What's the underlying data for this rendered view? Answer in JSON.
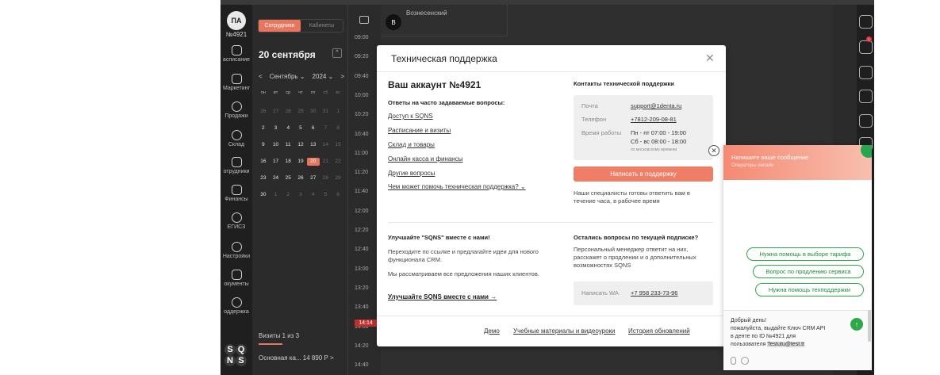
{
  "account": {
    "initials": "ПА",
    "number": "№4921"
  },
  "nav": [
    {
      "label": "асписание",
      "icon": "calendar-icon"
    },
    {
      "label": "Маркетинг",
      "icon": "chat-icon"
    },
    {
      "label": "Продажи",
      "icon": "tag-icon"
    },
    {
      "label": "Склад",
      "icon": "box-icon"
    },
    {
      "label": "отрудники",
      "icon": "users-icon"
    },
    {
      "label": "Финансы",
      "icon": "wallet-icon"
    },
    {
      "label": "ЕГИСЗ",
      "icon": "emblem-icon"
    },
    {
      "label": "Настройки",
      "icon": "gear-icon"
    },
    {
      "label": "окументы",
      "icon": "document-icon"
    },
    {
      "label": "оддержка",
      "icon": "question-icon"
    }
  ],
  "calendar": {
    "tabs": [
      "Сотрудники",
      "Кабинеты"
    ],
    "date_title": "20 сентября",
    "month": "Сентябрь",
    "year": "2024",
    "weekdays": [
      "пн",
      "вт",
      "ср",
      "чт",
      "пт",
      "сб",
      "вс"
    ],
    "weeks": [
      [
        "26",
        "27",
        "28",
        "29",
        "30",
        "31",
        "1"
      ],
      [
        "2",
        "3",
        "4",
        "5",
        "6",
        "7",
        "8"
      ],
      [
        "9",
        "10",
        "11",
        "12",
        "13",
        "14",
        "15"
      ],
      [
        "16",
        "17",
        "18",
        "19",
        "20",
        "21",
        "22"
      ],
      [
        "23",
        "24",
        "25",
        "26",
        "27",
        "28",
        "29"
      ],
      [
        "30",
        "1",
        "2",
        "3",
        "4",
        "5",
        "6"
      ]
    ],
    "selected": "20",
    "visits": "Визиты 1 из 3",
    "sale": "Основная ка... 14 890 Р"
  },
  "times": [
    "09:00",
    "09:20",
    "09:40",
    "10:00",
    "10:20",
    "10:40",
    "11:00",
    "11:20",
    "11:40",
    "12:00",
    "12:20",
    "12:40",
    "13:00",
    "13:20",
    "13:40",
    "14:00",
    "14:20",
    "14:40"
  ],
  "now_time": "14:14",
  "staff": {
    "initial": "В",
    "name": "Вознесенский"
  },
  "modal": {
    "title": "Техническая поддержка",
    "account_title": "Ваш аккаунт №4921",
    "faq_title": "Ответы на часто задаваемые вопросы:",
    "faq_links": [
      "Доступ к SQNS",
      "Расписание и визиты",
      "Склад и товары",
      "Онлайн касса и финансы",
      "Другие вопросы"
    ],
    "help_link": "Чем может помочь техническая поддержка?",
    "contacts_title": "Контакты технической поддержки",
    "contacts": {
      "mail_label": "Почта",
      "mail": "support@1denta.ru",
      "phone_label": "Телефон",
      "phone": "+7812-209-08-81",
      "hours_label": "Время работы",
      "hours_1": "Пн - пт 07:00 - 19:00",
      "hours_2": "Сб - вс 08:00 - 18:00",
      "hours_note": "по московскому времени"
    },
    "write_button": "Написать в поддержку",
    "response_note": "Наши специалисты готовы ответить вам в течение часа, в рабочее время",
    "improve_title": "Улучшайте \"SQNS\" вместе с нами!",
    "improve_p1": "Переходите по ссылке и предлагайте идеи для нового функционала CRM.",
    "improve_p2": "Мы рассматриваем все предложения наших клиентов.",
    "improve_link": "Улучшайте SQNS вместе с нами",
    "sub_title": "Остались вопросы по текущей подписке?",
    "sub_p": "Персональный менеджер ответит на них, расскажет о продлении и о дополнительных возможностях SQNS",
    "wa_label": "Написать WA",
    "wa_phone": "+7 958 233-73-96",
    "footer": [
      "Демо",
      "Учебные материалы и видеоуроки",
      "История обновлений"
    ]
  },
  "chat": {
    "title": "Напишите ваше сообщение",
    "subtitle": "Операторы онлайн",
    "chips": [
      "Нужна помощь в выборе тарифа",
      "Вопрос по продлению сервиса",
      "Нужна помощь техподдержки"
    ],
    "msg_1": "Добрый день!",
    "msg_2": "пожалуйста, выдайте Ключ CRM API",
    "msg_3": "в денте по ID №4921 для",
    "msg_4a": "пользователя ",
    "msg_4b": "Testutu@test.tt"
  },
  "colors": {
    "accent": "#ee7e65",
    "green": "#2fa84a",
    "dark": "#2b2b2b"
  }
}
